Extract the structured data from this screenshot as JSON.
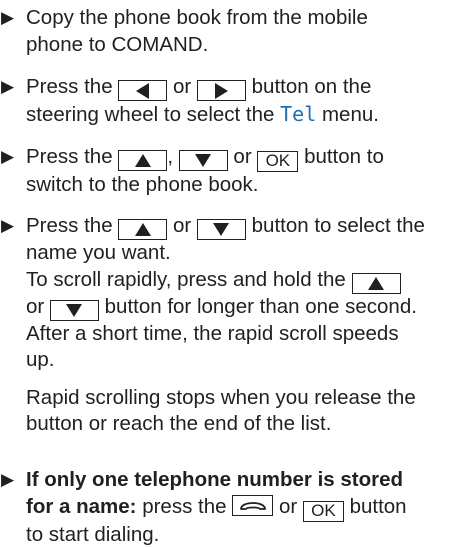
{
  "bullet_glyph": "▶",
  "steps": [
    {
      "lines": [
        "Copy the phone book from the mobile",
        "phone to COMAND."
      ]
    },
    {
      "before": "Press the",
      "or": "or",
      "after": "button on the",
      "line2_a": "steering wheel to select the",
      "menu_name": "Tel",
      "line2_b": "menu."
    },
    {
      "before": "Press the",
      "comma": ",",
      "or": "or",
      "ok": "OK",
      "after": "button to",
      "line2": "switch to the phone book."
    },
    {
      "before": "Press the",
      "or": "or",
      "after": "button to select the",
      "line2": "name you want.",
      "para1_line1": "To scroll rapidly, press and hold the",
      "para1_line2_or": "or",
      "para1_line2_rest": "button for longer than one second.",
      "para1_line3": "After a short time, the rapid scroll speeds",
      "para1_line4": "up.",
      "para2_line1": "Rapid scrolling stops when you release the",
      "para2_line2": "button or reach the end of the list."
    },
    {
      "bold_line1": "If only one telephone number is stored",
      "bold_line2": "for a name:",
      "press_the": "press the",
      "or": "or",
      "ok": "OK",
      "after": "button",
      "line3": "to start dialing."
    }
  ],
  "icons": {
    "left": "left-arrow-button-icon",
    "right": "right-arrow-button-icon",
    "up": "up-arrow-button-icon",
    "down": "down-arrow-button-icon",
    "phone": "phone-call-icon"
  },
  "colors": {
    "text": "#231f20",
    "menu_name": "#1f6fb2"
  }
}
